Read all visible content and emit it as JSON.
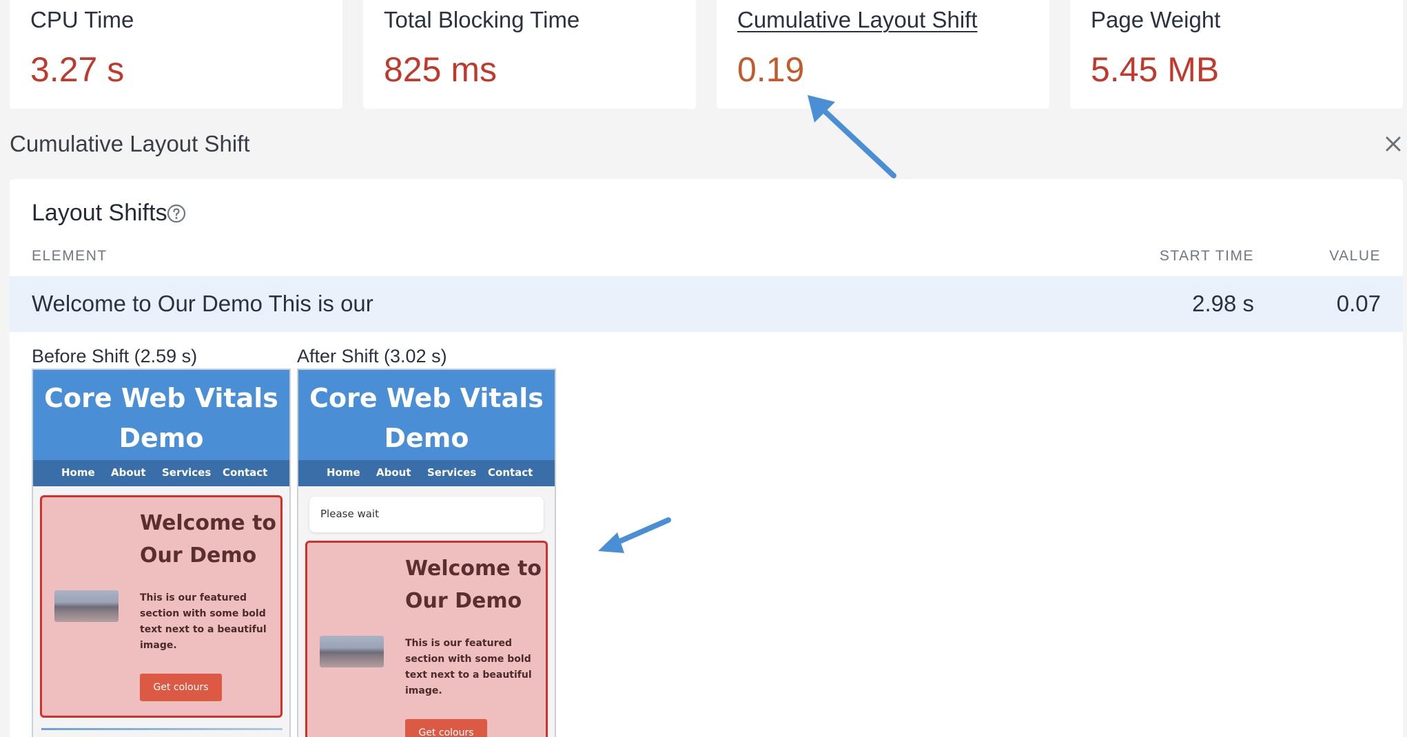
{
  "metrics": [
    {
      "label": "CPU Time",
      "value": "3.27 s"
    },
    {
      "label": "Total Blocking Time",
      "value": "825 ms"
    },
    {
      "label": "Cumulative Layout Shift",
      "value": "0.19"
    },
    {
      "label": "Page Weight",
      "value": "5.45 MB"
    }
  ],
  "panel": {
    "title": "Cumulative Layout Shift",
    "close_icon": "close-icon"
  },
  "layout_shifts": {
    "title": "Layout Shifts",
    "help_icon": "help-circle-icon",
    "columns": {
      "element": "ELEMENT",
      "start_time": "START TIME",
      "value": "VALUE"
    },
    "rows": [
      {
        "element": "Welcome to Our Demo This is our",
        "start_time": "2.98 s",
        "value": "0.07"
      }
    ]
  },
  "before": {
    "caption": "Before Shift (2.59 s)"
  },
  "after": {
    "caption": "After Shift (3.02 s)",
    "banner": "Please wait"
  },
  "demo": {
    "title_line1": "Core Web Vitals",
    "title_line2": "Demo",
    "nav": [
      "Home",
      "About",
      "Services",
      "Contact"
    ],
    "heading_line1": "Welcome to",
    "heading_line2": "Our Demo",
    "text_lines": [
      "This is our featured",
      "section with some bold",
      "text next to a beautiful",
      "image."
    ],
    "button": "Get colours"
  },
  "colors": {
    "metric_red": "#c0392b",
    "metric_orange": "#c25a2c",
    "row_highlight": "#e9f1fb",
    "annotation_arrow": "#4a8fd6",
    "demo_header": "#4a8fd6",
    "demo_nav": "#3a6ea8",
    "shift_border": "#d2302a"
  }
}
